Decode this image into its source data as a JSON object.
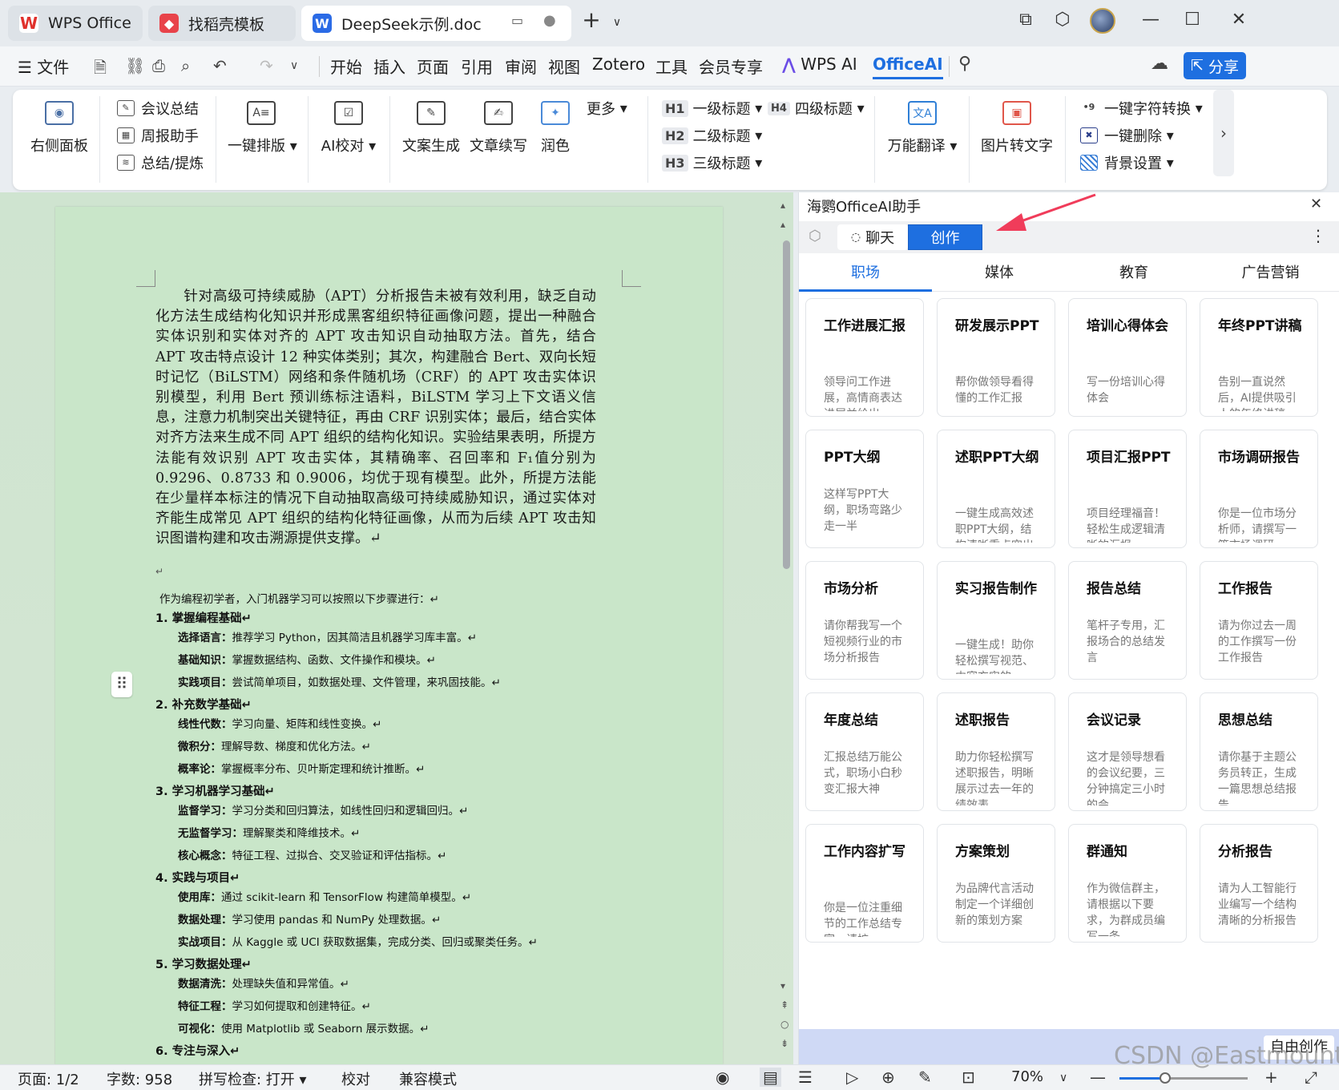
{
  "tabs": [
    {
      "label": "WPS Office",
      "icon": "wps-logo-icon"
    },
    {
      "label": "找稻壳模板",
      "icon": "docer-icon"
    },
    {
      "label": "DeepSeek示例.doc",
      "icon": "word-doc-icon"
    }
  ],
  "menu": {
    "file": "文件",
    "items": [
      "开始",
      "插入",
      "页面",
      "引用",
      "审阅",
      "视图",
      "Zotero",
      "工具",
      "会员专享"
    ],
    "wps_ai": "WPS AI",
    "officeai": "OfficeAI",
    "share": "分享"
  },
  "ribbon": {
    "right_panel": "右侧面板",
    "meeting_summary": "会议总结",
    "weekly_report": "周报助手",
    "summarize": "总结/提炼",
    "one_click_format": "一键排版",
    "ai_proofread": "AI校对",
    "copy_gen": "文案生成",
    "continue_write": "文章续写",
    "polish": "润色",
    "more": "更多",
    "h1": "一级标题",
    "h2": "二级标题",
    "h3": "三级标题",
    "h4": "四级标题",
    "h1_tag": "H1",
    "h2_tag": "H2",
    "h3_tag": "H3",
    "h4_tag": "H4",
    "translate": "万能翻译",
    "img2text": "图片转文字",
    "char_convert": "一键字符转换",
    "one_click_delete": "一键删除",
    "background": "背景设置"
  },
  "document": {
    "paragraph": "针对高级可持续威胁（APT）分析报告未被有效利用，缺乏自动化方法生成结构化知识并形成黑客组织特征画像问题，提出一种融合实体识别和实体对齐的 APT 攻击知识自动抽取方法。首先，结合 APT 攻击特点设计 12 种实体类别；其次，构建融合 Bert、双向长短时记忆（BiLSTM）网络和条件随机场（CRF）的 APT 攻击实体识别模型，利用 Bert 预训练标注语料，BiLSTM 学习上下文语义信息，注意力机制突出关键特征，再由 CRF 识别实体；最后，结合实体对齐方法来生成不同 APT 组织的结构化知识。实验结果表明，所提方法能有效识别 APT 攻击实体，其精确率、召回率和 F₁值分别为 0.9296、0.8733 和 0.9006，均优于现有模型。此外，所提方法能在少量样本标注的情况下自动抽取高级可持续威胁知识，通过实体对齐能生成常见 APT 组织的结构化特征画像，从而为后续 APT 攻击知识图谱构建和攻击溯源提供支撑。↵",
    "empty_mark": "↵",
    "intro": "作为编程初学者，入门机器学习可以按照以下步骤进行：↵",
    "sections": [
      {
        "title": "1. 掌握编程基础↵",
        "items": [
          {
            "k": "选择语言：",
            "v": "推荐学习 Python，因其简洁且机器学习库丰富。↵"
          },
          {
            "k": "基础知识：",
            "v": "掌握数据结构、函数、文件操作和模块。↵"
          },
          {
            "k": "实践项目：",
            "v": "尝试简单项目，如数据处理、文件管理，来巩固技能。↵"
          }
        ]
      },
      {
        "title": "2. 补充数学基础↵",
        "items": [
          {
            "k": "线性代数：",
            "v": "学习向量、矩阵和线性变换。↵"
          },
          {
            "k": "微积分：",
            "v": "理解导数、梯度和优化方法。↵"
          },
          {
            "k": "概率论：",
            "v": "掌握概率分布、贝叶斯定理和统计推断。↵"
          }
        ]
      },
      {
        "title": "3. 学习机器学习基础↵",
        "items": [
          {
            "k": "监督学习：",
            "v": "学习分类和回归算法，如线性回归和逻辑回归。↵"
          },
          {
            "k": "无监督学习：",
            "v": "理解聚类和降维技术。↵"
          },
          {
            "k": "核心概念：",
            "v": "特征工程、过拟合、交叉验证和评估指标。↵"
          }
        ]
      },
      {
        "title": "4. 实践与项目↵",
        "items": [
          {
            "k": "使用库：",
            "v": "通过 scikit-learn 和 TensorFlow 构建简单模型。↵"
          },
          {
            "k": "数据处理：",
            "v": "学习使用 pandas 和 NumPy 处理数据。↵"
          },
          {
            "k": "实战项目：",
            "v": "从 Kaggle 或 UCI 获取数据集，完成分类、回归或聚类任务。↵"
          }
        ]
      },
      {
        "title": "5. 学习数据处理↵",
        "items": [
          {
            "k": "数据清洗：",
            "v": "处理缺失值和异常值。↵"
          },
          {
            "k": "特征工程：",
            "v": "学习如何提取和创建特征。↵"
          },
          {
            "k": "可视化：",
            "v": "使用 Matplotlib 或 Seaborn 展示数据。↵"
          }
        ]
      },
      {
        "title": "6. 专注与深入↵",
        "items": []
      }
    ]
  },
  "panel": {
    "title": "海鹦OfficeAI助手",
    "mode_tabs": [
      "聊天",
      "创作"
    ],
    "active_mode": "创作",
    "categories": [
      "职场",
      "媒体",
      "教育",
      "广告营销"
    ],
    "active_category": "职场",
    "cards": [
      {
        "title": "工作进展汇报",
        "desc": "领导问工作进展，高情商表达进展并给出"
      },
      {
        "title": "研发展示PPT",
        "desc": "帮你做领导看得懂的工作汇报"
      },
      {
        "title": "培训心得体会",
        "desc": "写一份培训心得体会"
      },
      {
        "title": "年终PPT讲稿",
        "desc": "告别一直说然后，AI提供吸引人的年终讲稿"
      },
      {
        "title": "PPT大纲",
        "desc": "这样写PPT大纲，职场弯路少走一半"
      },
      {
        "title": "述职PPT大纲",
        "desc": "一键生成高效述职PPT大纲，结构清晰重点突出"
      },
      {
        "title": "项目汇报PPT",
        "desc": "项目经理福音！轻松生成逻辑清晰的汇报"
      },
      {
        "title": "市场调研报告",
        "desc": "你是一位市场分析师，请撰写一篇市场调研"
      },
      {
        "title": "市场分析",
        "desc": "请你帮我写一个短视频行业的市场分析报告"
      },
      {
        "title": "实习报告制作",
        "desc": "一键生成！助你轻松撰写视范、内容充实的"
      },
      {
        "title": "报告总结",
        "desc": "笔杆子专用，汇报场合的总结发言"
      },
      {
        "title": "工作报告",
        "desc": "请为你过去一周的工作撰写一份工作报告"
      },
      {
        "title": "年度总结",
        "desc": "汇报总结万能公式，职场小白秒变汇报大神"
      },
      {
        "title": "述职报告",
        "desc": "助力你轻松撰写述职报告，明晰展示过去一年的绩效表"
      },
      {
        "title": "会议记录",
        "desc": "这才是领导想看的会议纪要，三分钟搞定三小时的会"
      },
      {
        "title": "思想总结",
        "desc": "请你基于主题公务员转正，生成一篇思想总结报告"
      },
      {
        "title": "工作内容扩写",
        "desc": "你是一位注重细节的工作总结专家，请扩"
      },
      {
        "title": "方案策划",
        "desc": "为品牌代言活动制定一个详细创新的策划方案"
      },
      {
        "title": "群通知",
        "desc": "作为微信群主，请根据以下要求，为群成员编写一条"
      },
      {
        "title": "分析报告",
        "desc": "请为人工智能行业编写一个结构清晰的分析报告"
      }
    ],
    "free_create": "自由创作"
  },
  "status": {
    "page": "页面: 1/2",
    "words": "字数: 958",
    "spell": "拼写检查: 打开",
    "proof": "校对",
    "compat": "兼容模式",
    "zoom": "70%"
  },
  "watermark": "CSDN @Eastmount",
  "colors": {
    "accent": "#1e6fe0",
    "doc_bg": "#c9e6c9",
    "arrow": "#f03c5a"
  }
}
